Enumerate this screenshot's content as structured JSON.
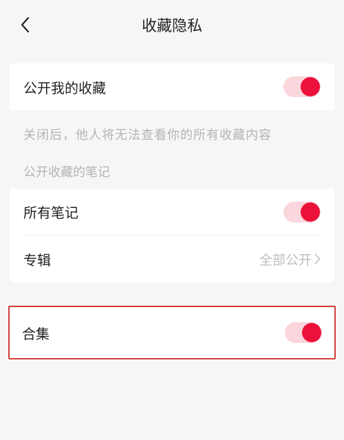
{
  "header": {
    "title": "收藏隐私"
  },
  "group1": {
    "publicMyFavorites": {
      "label": "公开我的收藏",
      "value": true
    }
  },
  "helpText": "关闭后，他人将无法查看你的所有收藏内容",
  "group2": {
    "label": "公开收藏的笔记",
    "allNotes": {
      "label": "所有笔记",
      "value": true
    },
    "albums": {
      "label": "专辑",
      "valueText": "全部公开"
    }
  },
  "group3": {
    "collections": {
      "label": "合集",
      "value": true
    }
  }
}
